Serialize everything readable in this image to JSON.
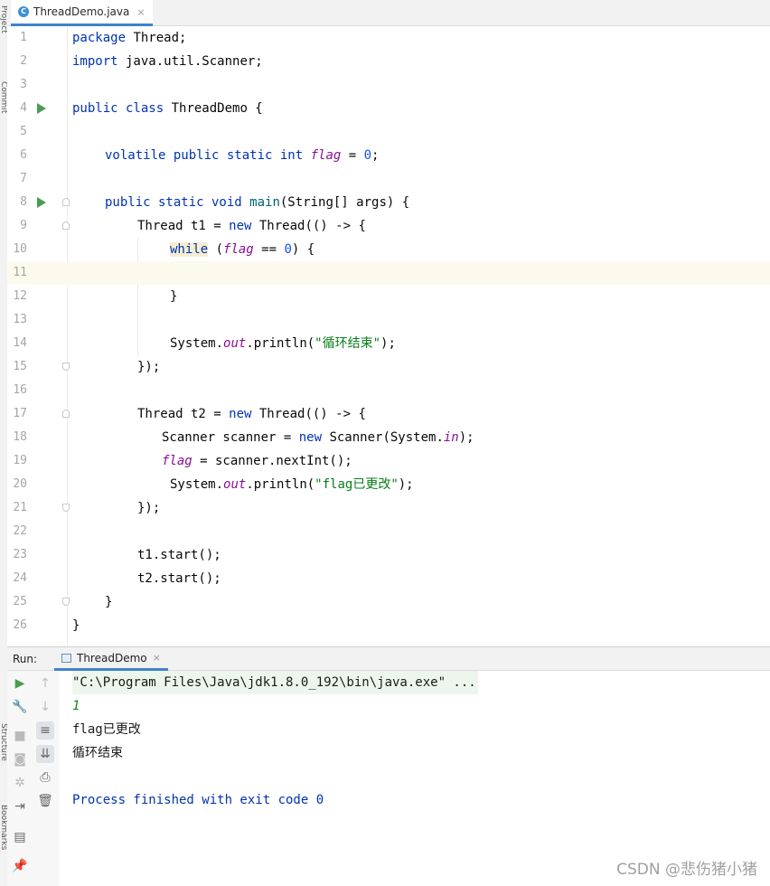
{
  "editor_tab": {
    "filename": "ThreadDemo.java",
    "icon_letter": "C",
    "close": "×"
  },
  "code_lines": [
    {
      "n": "1"
    },
    {
      "n": "2"
    },
    {
      "n": "3"
    },
    {
      "n": "4"
    },
    {
      "n": "5"
    },
    {
      "n": "6"
    },
    {
      "n": "7"
    },
    {
      "n": "8"
    },
    {
      "n": "9"
    },
    {
      "n": "10"
    },
    {
      "n": "11"
    },
    {
      "n": "12"
    },
    {
      "n": "13"
    },
    {
      "n": "14"
    },
    {
      "n": "15"
    },
    {
      "n": "16"
    },
    {
      "n": "17"
    },
    {
      "n": "18"
    },
    {
      "n": "19"
    },
    {
      "n": "20"
    },
    {
      "n": "21"
    },
    {
      "n": "22"
    },
    {
      "n": "23"
    },
    {
      "n": "24"
    },
    {
      "n": "25"
    },
    {
      "n": "26"
    }
  ],
  "code": {
    "l1": {
      "kw": "package",
      "rest": " Thread;"
    },
    "l2": {
      "kw": "import",
      "rest": " java.util.Scanner;"
    },
    "l4": {
      "kw": "public class",
      "rest": " ThreadDemo {"
    },
    "l6": {
      "kw": "volatile public static int",
      "fld": "flag",
      "mid": " = ",
      "num": "0",
      "end": ";"
    },
    "l8": {
      "kw": "public static void",
      "fn": "main",
      "rest": "(String[] args) {"
    },
    "l9": {
      "pre": "Thread t1 = ",
      "kw": "new",
      "rest": " Thread(() -> {"
    },
    "l10": {
      "kw": "while",
      "pre": " (",
      "fld": "flag",
      "mid": " == ",
      "num": "0",
      "end": ") {"
    },
    "l12": {
      "rest": "}"
    },
    "l14": {
      "pre": "System.",
      "fld": "out",
      "mid": ".println(",
      "str": "\"循环结束\"",
      "end": ");"
    },
    "l15": {
      "rest": "});"
    },
    "l17": {
      "pre": "Thread t2 = ",
      "kw": "new",
      "rest": " Thread(() -> {"
    },
    "l18": {
      "pre": "Scanner scanner = ",
      "kw": "new",
      "mid": " Scanner(System.",
      "fld": "in",
      "end": ");"
    },
    "l19": {
      "fld": "flag",
      "rest": " = scanner.nextInt();"
    },
    "l20": {
      "pre": "System.",
      "fld": "out",
      "mid": ".println(",
      "str": "\"flag已更改\"",
      "end": ");"
    },
    "l21": {
      "rest": "});"
    },
    "l23": {
      "rest": "t1.start();"
    },
    "l24": {
      "rest": "t2.start();"
    },
    "l25": {
      "rest": "}"
    },
    "l26": {
      "rest": "}"
    }
  },
  "run_panel": {
    "label": "Run:",
    "tab": "ThreadDemo",
    "close": "×"
  },
  "console": {
    "command": "\"C:\\Program Files\\Java\\jdk1.8.0_192\\bin\\java.exe\" ...",
    "input": "1",
    "output1": "flag已更改",
    "output2": "循环结束",
    "finish": "Process finished with exit code 0"
  },
  "side_labels": {
    "top": "Project",
    "commit": "Commit",
    "structure": "Structure",
    "bookmarks": "Bookmarks"
  },
  "watermark": "CSDN @悲伤猪小猪",
  "colors": {
    "keyword": "#0033b3",
    "string": "#067d17",
    "field": "#871094",
    "number": "#1750eb",
    "method": "#00627a",
    "accent": "#4083c9"
  }
}
